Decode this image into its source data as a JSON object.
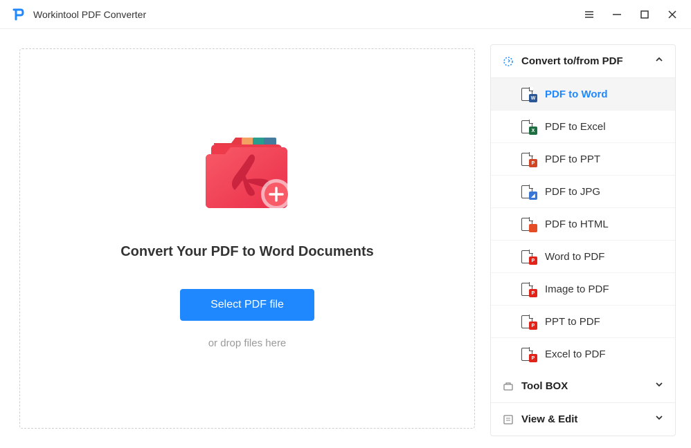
{
  "app": {
    "title": "Workintool PDF Converter"
  },
  "dropzone": {
    "heading": "Convert Your PDF to Word Documents",
    "buttonLabel": "Select PDF file",
    "hint": "or drop files here"
  },
  "sidebar": {
    "sections": [
      {
        "title": "Convert to/from PDF",
        "expanded": true,
        "items": [
          {
            "label": "PDF to Word",
            "active": true,
            "badge": "W",
            "badgeClass": "badge-word"
          },
          {
            "label": "PDF to Excel",
            "active": false,
            "badge": "X",
            "badgeClass": "badge-excel"
          },
          {
            "label": "PDF to PPT",
            "active": false,
            "badge": "P",
            "badgeClass": "badge-ppt"
          },
          {
            "label": "PDF to JPG",
            "active": false,
            "badge": "◢",
            "badgeClass": "badge-img"
          },
          {
            "label": "PDF to HTML",
            "active": false,
            "badge": "</>",
            "badgeClass": "badge-html"
          },
          {
            "label": "Word to PDF",
            "active": false,
            "badge": "P",
            "badgeClass": "badge-pdf"
          },
          {
            "label": "Image to PDF",
            "active": false,
            "badge": "P",
            "badgeClass": "badge-pdf"
          },
          {
            "label": "PPT to PDF",
            "active": false,
            "badge": "P",
            "badgeClass": "badge-pdf"
          },
          {
            "label": "Excel to PDF",
            "active": false,
            "badge": "P",
            "badgeClass": "badge-pdf"
          }
        ]
      },
      {
        "title": "Tool BOX",
        "expanded": false
      },
      {
        "title": "View & Edit",
        "expanded": false
      }
    ]
  }
}
